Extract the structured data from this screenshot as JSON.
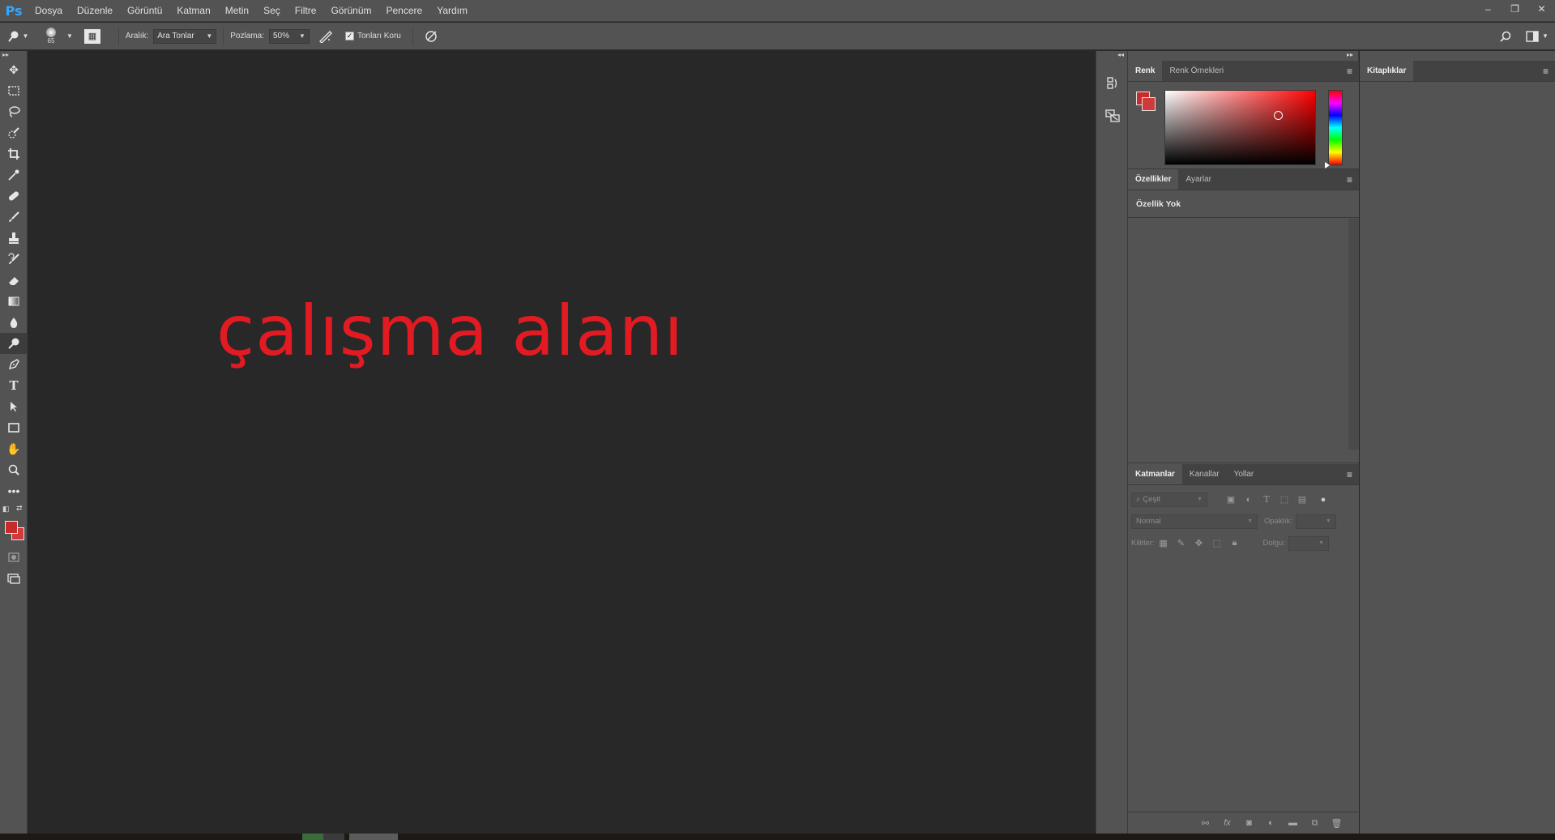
{
  "app": {
    "logo_text": "Ps",
    "menu": [
      "Dosya",
      "Düzenle",
      "Görüntü",
      "Katman",
      "Metin",
      "Seç",
      "Filtre",
      "Görünüm",
      "Pencere",
      "Yardım"
    ],
    "window_controls": {
      "minimize": "–",
      "restore": "❐",
      "close": "✕"
    }
  },
  "options_bar": {
    "brush_size": "65",
    "range_label": "Aralık:",
    "range_value": "Ara Tonlar",
    "exposure_label": "Pozlama:",
    "exposure_value": "50%",
    "protect_tones_label": "Tonları Koru",
    "protect_tones_checked": true
  },
  "toolbar": {
    "active_tool": "dodge-tool",
    "tools": [
      "move-tool",
      "marquee-tool",
      "lasso-tool",
      "quick-selection-tool",
      "crop-tool",
      "eyedropper-tool",
      "healing-brush-tool",
      "brush-tool",
      "clone-stamp-tool",
      "history-brush-tool",
      "eraser-tool",
      "gradient-tool",
      "blur-tool",
      "dodge-tool",
      "pen-tool",
      "type-tool",
      "path-selection-tool",
      "rectangle-tool",
      "hand-tool",
      "zoom-tool",
      "more-tools"
    ]
  },
  "workspace": {
    "overlay_text": "çalışma alanı",
    "overlay_color": "#e21b23"
  },
  "color_panel": {
    "tabs": [
      "Renk",
      "Renk Örnekleri"
    ],
    "active_tab": "Renk",
    "foreground_color": "#c92a2a",
    "background_color": "#d03a3a"
  },
  "properties_panel": {
    "tabs": [
      "Özellikler",
      "Ayarlar"
    ],
    "active_tab": "Özellikler",
    "header": "Özellik Yok"
  },
  "layers_panel": {
    "tabs": [
      "Katmanlar",
      "Kanallar",
      "Yollar"
    ],
    "active_tab": "Katmanlar",
    "filter_placeholder": "Çeşit",
    "blend_mode": "Normal",
    "opacity_label": "Opaklık:",
    "lock_label": "Kilitler:",
    "fill_label": "Dolgu:"
  },
  "library_panel": {
    "tab": "Kitaplıklar"
  },
  "colors": {
    "chrome": "#535353",
    "canvas": "#282828",
    "accent_logo": "#31a8ff"
  }
}
